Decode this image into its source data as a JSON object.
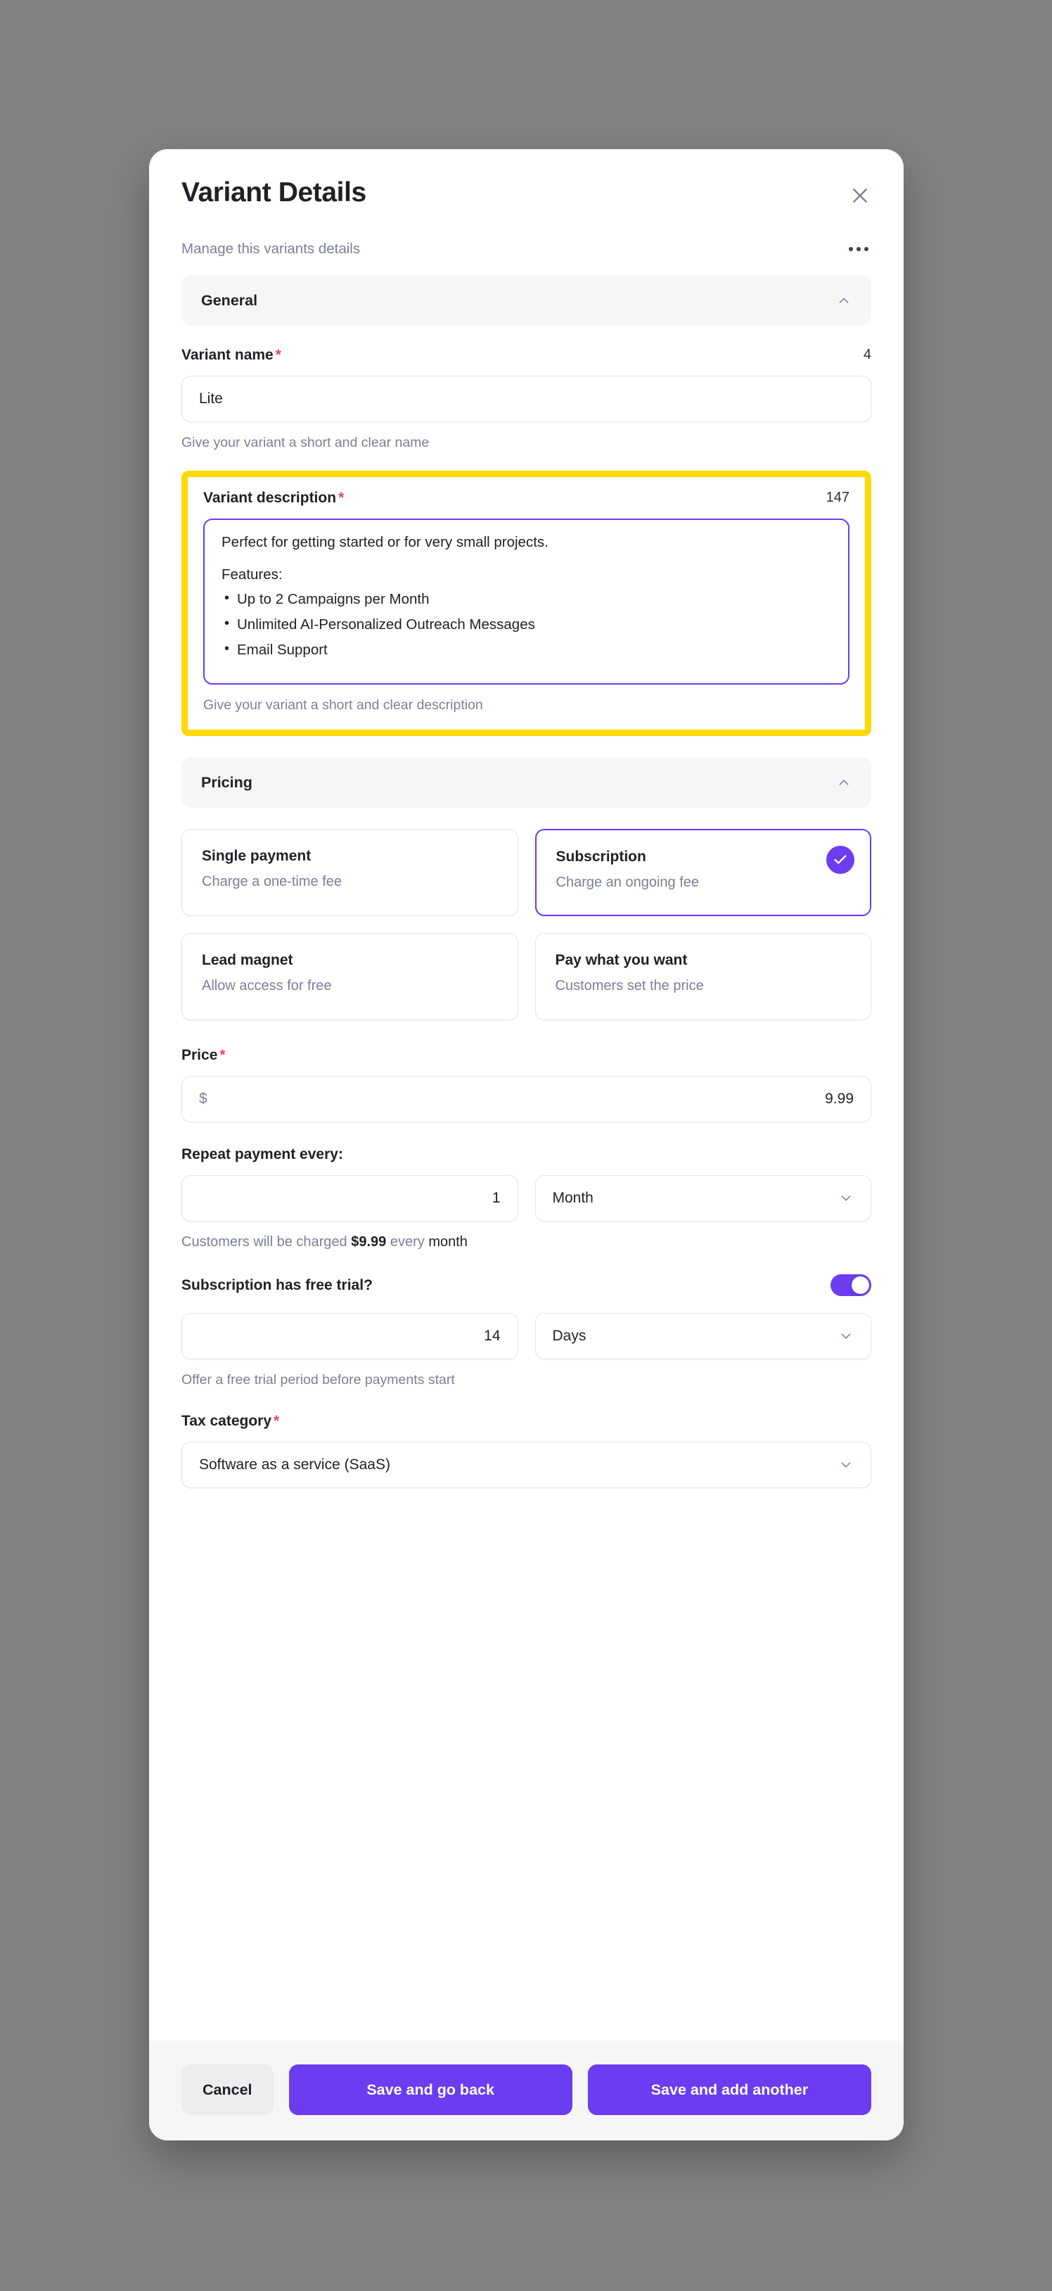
{
  "modal": {
    "title": "Variant Details",
    "subtitle": "Manage this variants details",
    "close_icon": "close-icon",
    "kebab_icon": "more-options-icon"
  },
  "sections": {
    "general": {
      "label": "General",
      "chevron": "chevron-up-icon"
    },
    "pricing": {
      "label": "Pricing",
      "chevron": "chevron-up-icon"
    }
  },
  "variant_name": {
    "label": "Variant name",
    "required_mark": "*",
    "counter": "4",
    "value": "Lite",
    "hint": "Give your variant a short and clear name"
  },
  "variant_description": {
    "label": "Variant description",
    "required_mark": "*",
    "counter": "147",
    "intro": "Perfect for getting started or for very small projects.",
    "features_label": "Features:",
    "features": [
      "Up to 2 Campaigns per Month",
      "Unlimited AI-Personalized Outreach Messages",
      "Email Support"
    ],
    "hint": "Give your variant a short and clear description"
  },
  "pricing_options": [
    {
      "title": "Single payment",
      "sub": "Charge a one-time fee",
      "selected": false
    },
    {
      "title": "Subscription",
      "sub": "Charge an ongoing fee",
      "selected": true
    },
    {
      "title": "Lead magnet",
      "sub": "Allow access for free",
      "selected": false
    },
    {
      "title": "Pay what you want",
      "sub": "Customers set the price",
      "selected": false
    }
  ],
  "price": {
    "label": "Price",
    "required_mark": "*",
    "currency": "$",
    "value": "9.99"
  },
  "repeat": {
    "label": "Repeat payment every:",
    "interval": "1",
    "unit": "Month",
    "unit_chevron": "chevron-down-icon",
    "note_prefix": "Customers will be charged ",
    "note_amount": "$9.99",
    "note_middle": " every ",
    "note_unit": "month"
  },
  "free_trial": {
    "label": "Subscription has free trial?",
    "enabled": true,
    "duration": "14",
    "unit": "Days",
    "unit_chevron": "chevron-down-icon",
    "hint": "Offer a free trial period before payments start"
  },
  "tax_category": {
    "label": "Tax category",
    "required_mark": "*",
    "value": "Software as a service (SaaS)",
    "chevron": "chevron-down-icon"
  },
  "footer": {
    "cancel": "Cancel",
    "save_go_back": "Save and go back",
    "save_add_another": "Save and add another"
  },
  "colors": {
    "accent": "#6b3cf0",
    "highlight": "#ffd900",
    "required": "#ef4070",
    "muted": "#7b7f99",
    "surface": "#f6f6f7",
    "backdrop": "#828282"
  }
}
